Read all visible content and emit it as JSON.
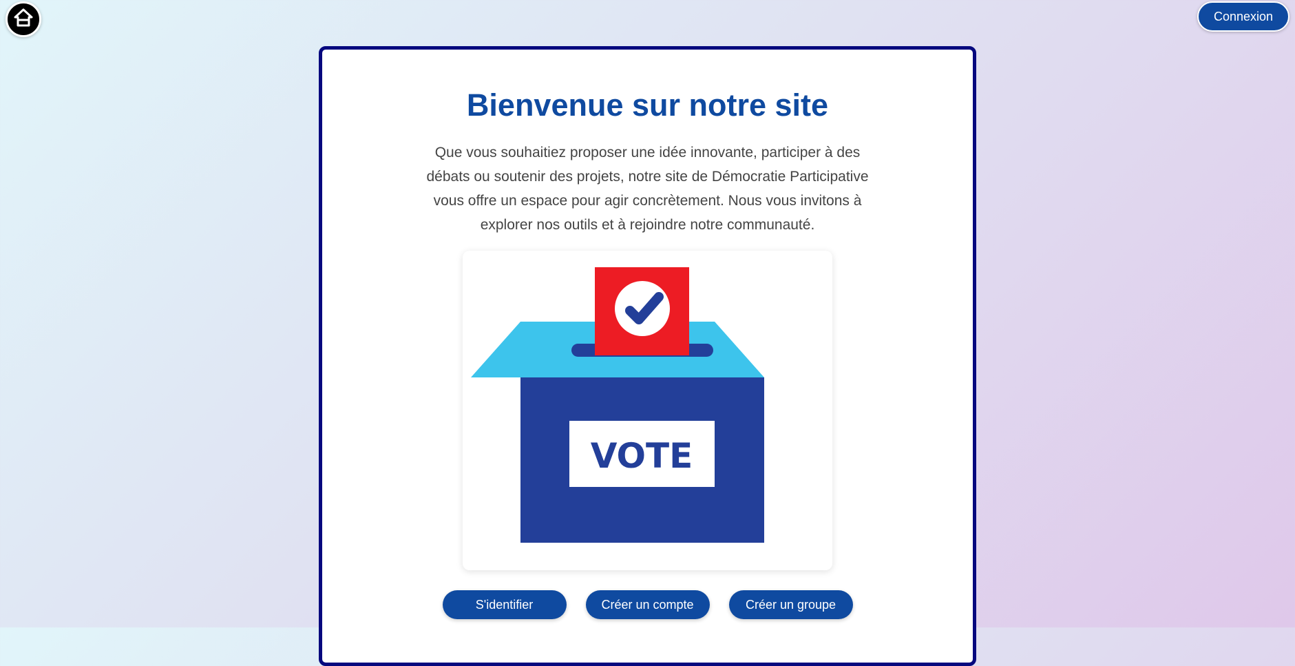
{
  "header": {
    "home_icon": "home-icon",
    "login_label": "Connexion"
  },
  "welcome": {
    "title": "Bienvenue sur notre site",
    "intro": "Que vous souhaitiez proposer une idée innovante, participer à des débats ou soutenir des projets, notre site de Démocratie Participative vous offre un espace pour agir concrètement. Nous vous invitons à explorer nos outils et à rejoindre notre communauté.",
    "illustration": {
      "icon": "ballot-box-icon",
      "box_label": "VOTE"
    }
  },
  "actions": {
    "identify_label": "S'identifier",
    "create_account_label": "Créer un compte",
    "create_group_label": "Créer un groupe"
  },
  "colors": {
    "brand": "#0f4aa0",
    "card_border": "#06087e",
    "ballot_box": "#233f99",
    "ballot_lid": "#3dc4ec",
    "ballot_paper": "#ed1c24"
  }
}
